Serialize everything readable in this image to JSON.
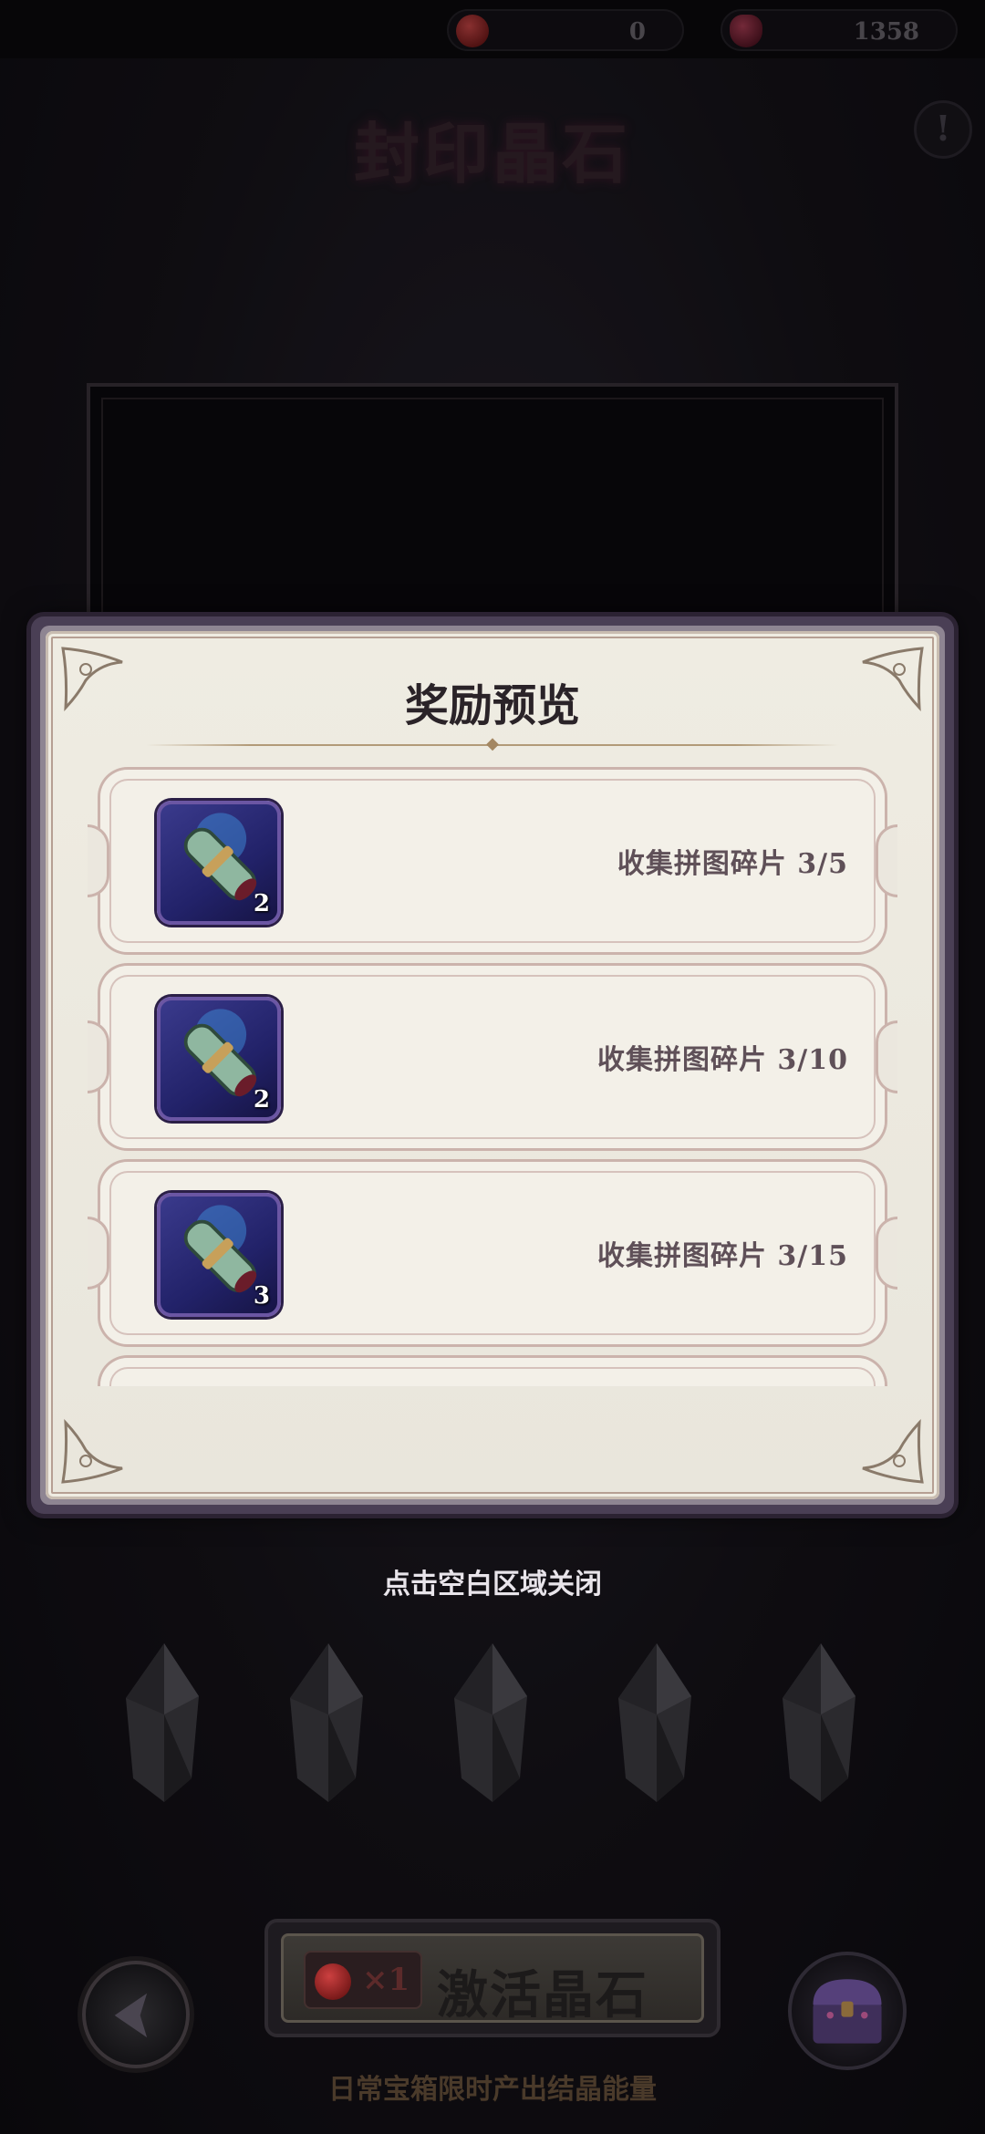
{
  "topbar": {
    "currency_1": {
      "icon": "red-gem-icon",
      "value": "0"
    },
    "currency_2": {
      "icon": "crystal-heart-icon",
      "value": "1358"
    }
  },
  "page": {
    "title": "封印晶石",
    "info_icon": "exclamation-icon"
  },
  "modal": {
    "title": "奖励预览",
    "rewards": [
      {
        "icon": "scroll-icon",
        "count": "2",
        "label": "收集拼图碎片 3/5"
      },
      {
        "icon": "scroll-icon",
        "count": "2",
        "label": "收集拼图碎片 3/10"
      },
      {
        "icon": "scroll-icon",
        "count": "3",
        "label": "收集拼图碎片 3/15"
      },
      {
        "icon": "scroll-icon",
        "count": "",
        "label": ""
      }
    ],
    "close_hint": "点击空白区域关闭"
  },
  "crystals": [
    "crystal-icon",
    "crystal-icon",
    "crystal-icon",
    "crystal-icon",
    "crystal-icon"
  ],
  "bottom": {
    "activate_label": "激活晶石",
    "cost_text": "×1",
    "back_icon": "back-arrow-icon",
    "chest_icon": "treasure-chest-icon",
    "tip": "日常宝箱限时产出结晶能量"
  },
  "colors": {
    "panel_bg": "#efece2",
    "panel_border": "#4a3f55",
    "icon_bg": "#222269",
    "text_dark": "#2a2328"
  }
}
